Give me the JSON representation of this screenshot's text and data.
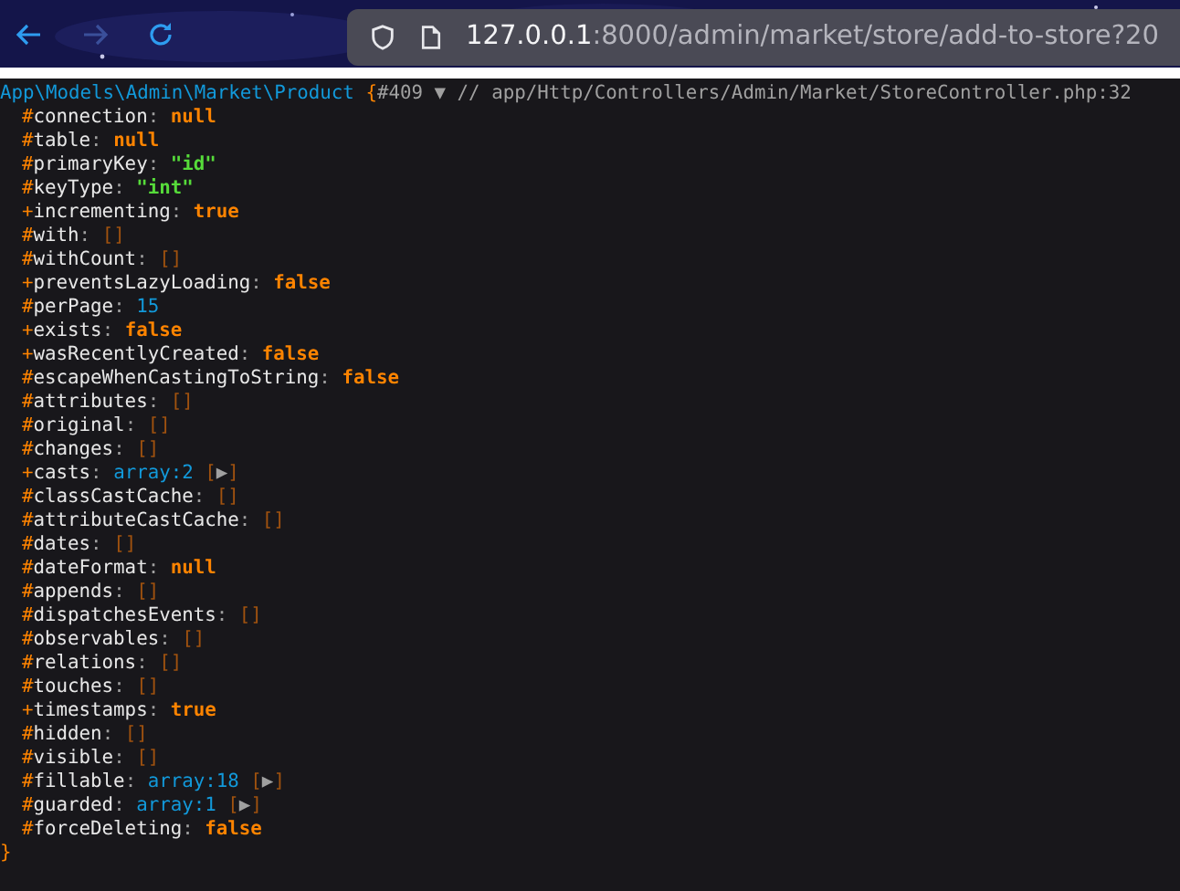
{
  "toolbar": {
    "nav_buttons": [
      {
        "kind": "back",
        "disabled": false
      },
      {
        "kind": "forward",
        "disabled": true
      },
      {
        "kind": "reload",
        "disabled": false
      }
    ],
    "address": {
      "host": "127.0.0.1",
      "path": ":8000/admin/market/store/add-to-store?20"
    }
  },
  "dump": {
    "class_name": "App\\Models\\Admin\\Market\\Product",
    "open_brace": "{",
    "object_id": "#409",
    "toggle": "▼",
    "comment": "// app/Http/Controllers/Admin/Market/StoreController.php:32",
    "close_brace": "}",
    "properties": [
      {
        "modifier": "#",
        "name": "connection",
        "separator": ":",
        "kind": "null",
        "value": "null"
      },
      {
        "modifier": "#",
        "name": "table",
        "separator": ":",
        "kind": "null",
        "value": "null"
      },
      {
        "modifier": "#",
        "name": "primaryKey",
        "separator": ":",
        "kind": "string",
        "value": "\"id\""
      },
      {
        "modifier": "#",
        "name": "keyType",
        "separator": ":",
        "kind": "string",
        "value": "\"int\""
      },
      {
        "modifier": "+",
        "name": "incrementing",
        "separator": ":",
        "kind": "bool",
        "value": "true"
      },
      {
        "modifier": "#",
        "name": "with",
        "separator": ":",
        "kind": "empty",
        "value": "[]"
      },
      {
        "modifier": "#",
        "name": "withCount",
        "separator": ":",
        "kind": "empty",
        "value": "[]"
      },
      {
        "modifier": "+",
        "name": "preventsLazyLoading",
        "separator": ":",
        "kind": "bool",
        "value": "false"
      },
      {
        "modifier": "#",
        "name": "perPage",
        "separator": ":",
        "kind": "number",
        "value": "15"
      },
      {
        "modifier": "+",
        "name": "exists",
        "separator": ":",
        "kind": "bool",
        "value": "false"
      },
      {
        "modifier": "+",
        "name": "wasRecentlyCreated",
        "separator": ":",
        "kind": "bool",
        "value": "false"
      },
      {
        "modifier": "#",
        "name": "escapeWhenCastingToString",
        "separator": ":",
        "kind": "bool",
        "value": "false"
      },
      {
        "modifier": "#",
        "name": "attributes",
        "separator": ":",
        "kind": "empty",
        "value": "[]"
      },
      {
        "modifier": "#",
        "name": "original",
        "separator": ":",
        "kind": "empty",
        "value": "[]"
      },
      {
        "modifier": "#",
        "name": "changes",
        "separator": ":",
        "kind": "empty",
        "value": "[]"
      },
      {
        "modifier": "+",
        "name": "casts",
        "separator": ":",
        "kind": "array",
        "value": "array:2",
        "expander": "[▶]"
      },
      {
        "modifier": "#",
        "name": "classCastCache",
        "separator": ":",
        "kind": "empty",
        "value": "[]"
      },
      {
        "modifier": "#",
        "name": "attributeCastCache",
        "separator": ":",
        "kind": "empty",
        "value": "[]"
      },
      {
        "modifier": "#",
        "name": "dates",
        "separator": ":",
        "kind": "empty",
        "value": "[]"
      },
      {
        "modifier": "#",
        "name": "dateFormat",
        "separator": ":",
        "kind": "null",
        "value": "null"
      },
      {
        "modifier": "#",
        "name": "appends",
        "separator": ":",
        "kind": "empty",
        "value": "[]"
      },
      {
        "modifier": "#",
        "name": "dispatchesEvents",
        "separator": ":",
        "kind": "empty",
        "value": "[]"
      },
      {
        "modifier": "#",
        "name": "observables",
        "separator": ":",
        "kind": "empty",
        "value": "[]"
      },
      {
        "modifier": "#",
        "name": "relations",
        "separator": ":",
        "kind": "empty",
        "value": "[]"
      },
      {
        "modifier": "#",
        "name": "touches",
        "separator": ":",
        "kind": "empty",
        "value": "[]"
      },
      {
        "modifier": "+",
        "name": "timestamps",
        "separator": ":",
        "kind": "bool",
        "value": "true"
      },
      {
        "modifier": "#",
        "name": "hidden",
        "separator": ":",
        "kind": "empty",
        "value": "[]"
      },
      {
        "modifier": "#",
        "name": "visible",
        "separator": ":",
        "kind": "empty",
        "value": "[]"
      },
      {
        "modifier": "#",
        "name": "fillable",
        "separator": ":",
        "kind": "array",
        "value": "array:18",
        "expander": "[▶]"
      },
      {
        "modifier": "#",
        "name": "guarded",
        "separator": ":",
        "kind": "array",
        "value": "array:1",
        "expander": "[▶]"
      },
      {
        "modifier": "#",
        "name": "forceDeleting",
        "separator": ":",
        "kind": "bool",
        "value": "false"
      }
    ]
  }
}
